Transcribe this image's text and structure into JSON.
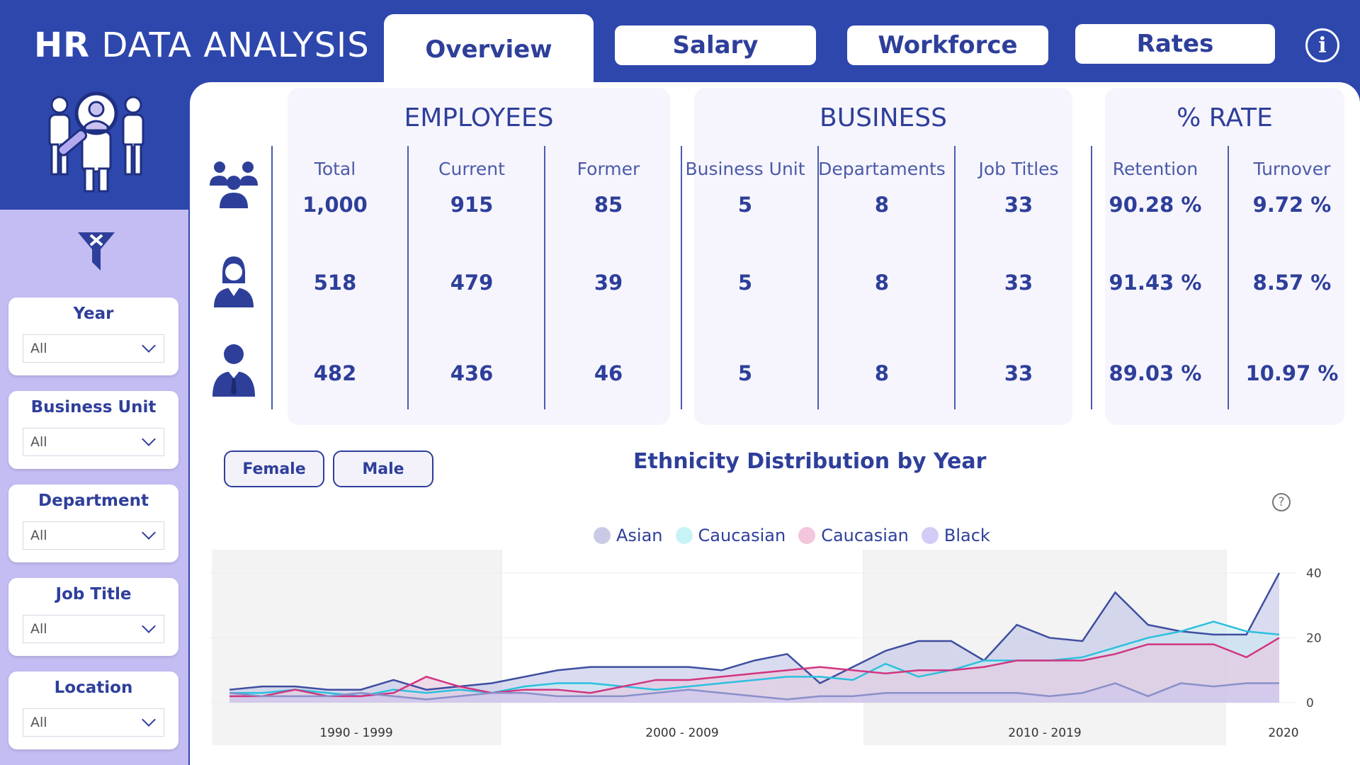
{
  "header": {
    "title_bold": "HR",
    "title_rest": " DATA ANALYSIS",
    "tabs": [
      {
        "label": "Overview",
        "active": true
      },
      {
        "label": "Salary",
        "active": false
      },
      {
        "label": "Workforce",
        "active": false
      },
      {
        "label": "Rates",
        "active": false
      }
    ],
    "info_icon": "i"
  },
  "sidebar": {
    "slicers": [
      {
        "title": "Year",
        "value": "All"
      },
      {
        "title": "Business Unit",
        "value": "All"
      },
      {
        "title": "Department",
        "value": "All"
      },
      {
        "title": "Job Title",
        "value": "All"
      },
      {
        "title": "Location",
        "value": "All"
      }
    ]
  },
  "cards": {
    "employees": {
      "title": "EMPLOYEES",
      "columns": [
        "Total",
        "Current",
        "Former"
      ]
    },
    "business": {
      "title": "BUSINESS",
      "columns": [
        "Business Unit",
        "Departaments",
        "Job Titles"
      ]
    },
    "rate": {
      "title": "% RATE",
      "columns": [
        "Retention",
        "Turnover"
      ]
    }
  },
  "rows": [
    {
      "icon": "group-icon",
      "values": [
        "1,000",
        "915",
        "85",
        "5",
        "8",
        "33",
        "90.28 %",
        "9.72 %"
      ]
    },
    {
      "icon": "female-icon",
      "values": [
        "518",
        "479",
        "39",
        "5",
        "8",
        "33",
        "91.43 %",
        "8.57 %"
      ]
    },
    {
      "icon": "male-icon",
      "values": [
        "482",
        "436",
        "46",
        "5",
        "8",
        "33",
        "89.03 %",
        "10.97 %"
      ]
    }
  ],
  "gender_buttons": [
    "Female",
    "Male"
  ],
  "help_icon": "?",
  "colors": {
    "primary": "#2e47ad",
    "sidebar": "#c3bdf3",
    "text": "#2e3f9a"
  },
  "chart_data": {
    "type": "area",
    "title": "Ethnicity Distribution by Year",
    "x_groups": [
      "1990 - 1999",
      "2000 - 2009",
      "2010 - 2019",
      "2020"
    ],
    "y_ticks": [
      0,
      20,
      40
    ],
    "ylim": [
      0,
      45
    ],
    "legend_position": "top-center",
    "series": [
      {
        "name": "Asian",
        "legend_color": "#c9cbe6",
        "line_color": "#3e4ea0",
        "fill": "#b9bde3",
        "values": [
          4,
          5,
          5,
          4,
          4,
          7,
          4,
          5,
          6,
          8,
          10,
          11,
          11,
          11,
          11,
          10,
          13,
          15,
          6,
          11,
          16,
          19,
          19,
          13,
          24,
          20,
          19,
          34,
          24,
          22,
          21,
          21,
          40
        ]
      },
      {
        "name": "Caucasian",
        "legend_color": "#c8f3f6",
        "line_color": "#2bc0dd",
        "fill": "#cbe9f2",
        "values": [
          3,
          3,
          4,
          3,
          2,
          4,
          3,
          4,
          3,
          5,
          6,
          6,
          5,
          4,
          5,
          6,
          7,
          8,
          8,
          7,
          12,
          8,
          10,
          13,
          13,
          13,
          14,
          17,
          20,
          22,
          25,
          22,
          21
        ]
      },
      {
        "name": "Caucasian",
        "legend_color": "#f2c6dc",
        "line_color": "#d1357f",
        "fill": "#ebc4dc",
        "values": [
          2,
          2,
          4,
          2,
          2,
          3,
          8,
          5,
          3,
          4,
          4,
          3,
          5,
          7,
          7,
          8,
          9,
          10,
          11,
          10,
          9,
          10,
          10,
          11,
          13,
          13,
          13,
          15,
          18,
          18,
          18,
          14,
          20
        ]
      },
      {
        "name": "Black",
        "legend_color": "#d2cdf6",
        "line_color": "#8a90c8",
        "fill": "#c9c2f1",
        "values": [
          3,
          2,
          2,
          2,
          3,
          2,
          1,
          2,
          3,
          3,
          2,
          2,
          2,
          3,
          4,
          3,
          2,
          1,
          2,
          2,
          3,
          3,
          3,
          3,
          3,
          2,
          3,
          6,
          2,
          6,
          5,
          6,
          6
        ]
      }
    ]
  }
}
